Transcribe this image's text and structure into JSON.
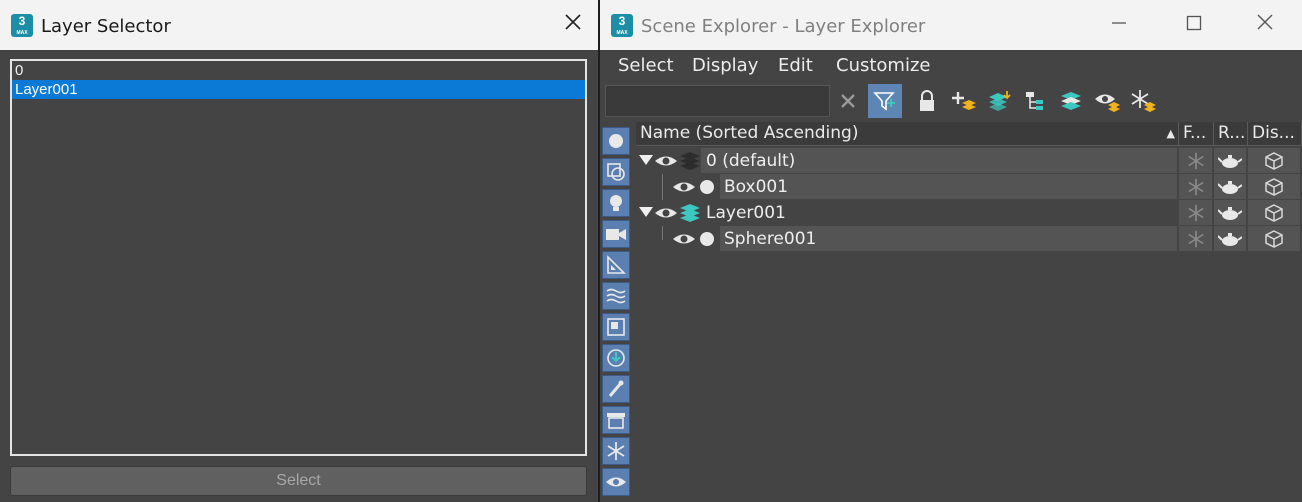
{
  "layer_selector": {
    "title": "Layer Selector",
    "app_icon": {
      "num": "3",
      "tag": "MAX"
    },
    "items": [
      "0",
      "Layer001"
    ],
    "selected_index": 1,
    "select_label": "Select"
  },
  "scene_explorer": {
    "title": "Scene Explorer - Layer Explorer",
    "app_icon": {
      "num": "3",
      "tag": "MAX"
    },
    "menu": [
      "Select",
      "Display",
      "Edit",
      "Customize"
    ],
    "search_value": "",
    "columns": {
      "name": "Name (Sorted Ascending)",
      "frozen": "F...",
      "render": "R...",
      "display": "Dis..."
    },
    "rows": [
      {
        "label": "0 (default)",
        "kind": "layer"
      },
      {
        "label": "Box001",
        "kind": "object"
      },
      {
        "label": "Layer001",
        "kind": "layer"
      },
      {
        "label": "Sphere001",
        "kind": "object"
      }
    ],
    "accent": "#0a7ad6",
    "layer_icon_color": "#3cc8c0"
  }
}
